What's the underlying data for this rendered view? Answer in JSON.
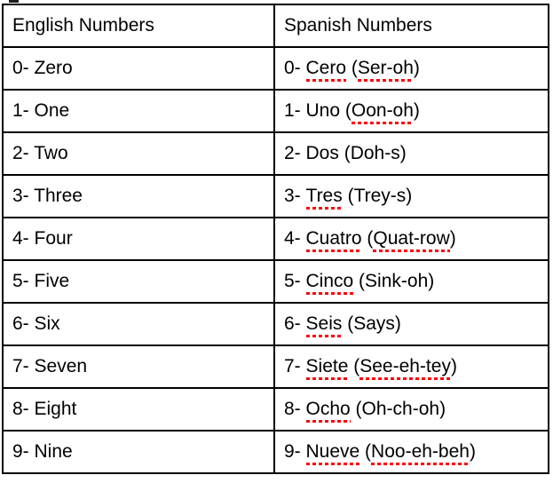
{
  "table": {
    "columns": [
      {
        "key": "english",
        "label": "English Numbers"
      },
      {
        "key": "spanish",
        "label": "Spanish Numbers"
      }
    ],
    "spellcheck_underline_color": "#fb0007",
    "rows": [
      {
        "english": "0- Zero",
        "spanish_prefix": "0- ",
        "spanish_word": "Cero",
        "spanish_word_flagged": true,
        "spanish_pron_open": " (",
        "spanish_pron": "Ser-oh",
        "spanish_pron_flagged": true,
        "spanish_pron_close": ")"
      },
      {
        "english": "1- One",
        "spanish_prefix": "1- ",
        "spanish_word": "Uno",
        "spanish_word_flagged": false,
        "spanish_pron_open": " (",
        "spanish_pron": "Oon-oh",
        "spanish_pron_flagged": true,
        "spanish_pron_close": ")"
      },
      {
        "english": "2- Two",
        "spanish_prefix": "2- ",
        "spanish_word": "Dos",
        "spanish_word_flagged": false,
        "spanish_pron_open": " (",
        "spanish_pron": "Doh-s",
        "spanish_pron_flagged": false,
        "spanish_pron_close": ")"
      },
      {
        "english": "3- Three",
        "spanish_prefix": "3- ",
        "spanish_word": "Tres",
        "spanish_word_flagged": true,
        "spanish_pron_open": " (",
        "spanish_pron": "Trey-s",
        "spanish_pron_flagged": false,
        "spanish_pron_close": ")"
      },
      {
        "english": "4- Four",
        "spanish_prefix": "4- ",
        "spanish_word": "Cuatro",
        "spanish_word_flagged": true,
        "spanish_pron_open": " (",
        "spanish_pron": "Quat-row",
        "spanish_pron_flagged": true,
        "spanish_pron_close": ")"
      },
      {
        "english": "5- Five",
        "spanish_prefix": "5- ",
        "spanish_word": "Cinco",
        "spanish_word_flagged": true,
        "spanish_pron_open": " (",
        "spanish_pron": "Sink-oh",
        "spanish_pron_flagged": false,
        "spanish_pron_close": ")"
      },
      {
        "english": "6- Six",
        "spanish_prefix": "6- ",
        "spanish_word": "Seis",
        "spanish_word_flagged": true,
        "spanish_pron_open": " (",
        "spanish_pron": "Says",
        "spanish_pron_flagged": false,
        "spanish_pron_close": ")"
      },
      {
        "english": "7- Seven",
        "spanish_prefix": "7- ",
        "spanish_word": "Siete",
        "spanish_word_flagged": true,
        "spanish_pron_open": " (",
        "spanish_pron": "See-eh-tey",
        "spanish_pron_flagged": true,
        "spanish_pron_close": ")"
      },
      {
        "english": "8- Eight",
        "spanish_prefix": "8- ",
        "spanish_word": "Ocho",
        "spanish_word_flagged": true,
        "spanish_pron_open": " (",
        "spanish_pron": "Oh-ch-oh",
        "spanish_pron_flagged": false,
        "spanish_pron_close": ")"
      },
      {
        "english": "9- Nine",
        "spanish_prefix": "9- ",
        "spanish_word": "Nueve",
        "spanish_word_flagged": true,
        "spanish_pron_open": " (",
        "spanish_pron": "Noo-eh-beh",
        "spanish_pron_flagged": true,
        "spanish_pron_close": ")"
      }
    ]
  }
}
